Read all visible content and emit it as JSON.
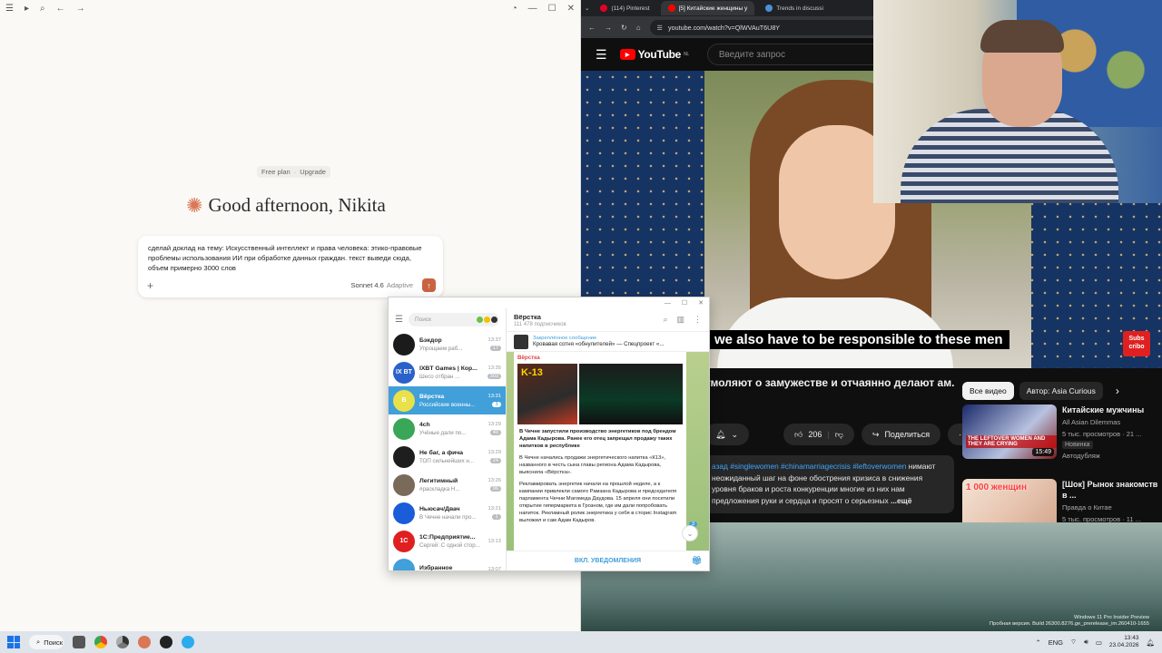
{
  "claude": {
    "plan": "Free plan",
    "upgrade": "Upgrade",
    "greeting": "Good afternoon, Nikita",
    "prompt": "сделай доклад на тему: Искусственный интеллект и права человека: этико-правовые проблемы использования ИИ при обработке данных граждан. текст выведи сюда, объем примерно 3000 слов",
    "model": "Sonnet 4.6",
    "mode": "Adaptive",
    "accent": "#d97757"
  },
  "chrome": {
    "tabs": [
      {
        "label": "(114) Pinterest",
        "color": "#e60023"
      },
      {
        "label": "[5] Китайские женщины у",
        "color": "#ff0000"
      },
      {
        "label": "Trends in discussi",
        "color": "#4a90d9"
      }
    ],
    "url": "youtube.com/watch?v=QlWVAuT6U8Y"
  },
  "youtube": {
    "logo": "YouTube",
    "region": "NL",
    "search_placeholder": "Введите запрос",
    "caption": "we also have to be responsible to these men",
    "subscribe_logo": "Subs cribo",
    "title": "умоляют о замужестве и отчаянно делают ам.",
    "likes": "206",
    "share": "Поделиться",
    "description": {
      "tags": "азад #singlewomen #chinamarriagecrisis #leftoverwomen",
      "text": "нимают неожиданный шаг на фоне обострения кризиса в снижения уровня браков и роста конкуренции многие из них нам предложения руки и сердца и просят о серьезных",
      "more": "...ещё"
    },
    "chips": [
      "Все видео",
      "Автор: Asia Curious"
    ],
    "related": [
      {
        "title": "Китайские мужчины",
        "channel": "All Asian Dilemmas",
        "meta": "5 тыс. просмотров · 21 ...",
        "badge": "Новинка",
        "dub": "Автодубляж",
        "duration": "15:49",
        "thumb_text": "THE LEFTOVER WOMEN AND THEY ARE CRYING"
      },
      {
        "title": "[Шок] Рынок знакомств в ...",
        "channel": "Правда о Китае",
        "meta": "5 тыс. просмотров · 11 ...",
        "badge": "",
        "dub": "",
        "duration": "",
        "thumb_text": "1 000 женщин"
      }
    ]
  },
  "telegram": {
    "search_placeholder": "Поиск",
    "chats": [
      {
        "name": "Бэкдор",
        "preview": "Упрощаем раб...",
        "time": "13:37",
        "count": "17",
        "avatar_color": "#1b1b1b",
        "avatar_text": "",
        "active": false
      },
      {
        "name": "IXBT Games | Кор...",
        "preview": "Шесо отбран ...",
        "time": "13:35",
        "count": "303",
        "avatar_color": "#2a62c9",
        "avatar_text": "IX BT",
        "active": false
      },
      {
        "name": "Вёрстка",
        "preview": "Российские военны...",
        "time": "13:31",
        "count": "3",
        "avatar_color": "#e8e14a",
        "avatar_text": "B",
        "active": true
      },
      {
        "name": "4ch",
        "preview": "Учёные дали по...",
        "time": "13:29",
        "count": "40",
        "avatar_color": "#3aa657",
        "avatar_text": "",
        "active": false
      },
      {
        "name": "Не баг, а фича",
        "preview": "ТОП сильнейших н...",
        "time": "13:29",
        "count": "24",
        "avatar_color": "#1e1e1e",
        "avatar_text": "",
        "active": false
      },
      {
        "name": "Легитимный",
        "preview": "#раскладка Н...",
        "time": "13:26",
        "count": "96",
        "avatar_color": "#7a6a5a",
        "avatar_text": "",
        "active": false
      },
      {
        "name": "Ньюсач/Двач",
        "preview": "В Чечне начали про...",
        "time": "13:21",
        "count": "1",
        "avatar_color": "#1a5dd8",
        "avatar_text": "",
        "active": false
      },
      {
        "name": "1С:Предприятие...",
        "preview": "Сергей: С одной стор...",
        "time": "13:13",
        "count": "",
        "avatar_color": "#e02020",
        "avatar_text": "1С",
        "active": false
      },
      {
        "name": "Избранное",
        "preview": "",
        "time": "13:07",
        "count": "",
        "avatar_color": "#419fd9",
        "avatar_text": "",
        "active": false
      }
    ],
    "channel": {
      "name": "Вёрстка",
      "subscribers": "111 478 подписчиков",
      "pinned_label": "Закреплённое сообщение",
      "pinned_text": "Кровавая сотня «обнулителей» — Спецпроект «...",
      "author": "Вёрстка",
      "image_text": "K-13",
      "paragraphs": [
        "В Чечне запустили производство энергетиков под брендом Адама Кадырова. Ранее его отец запрещал продажу таких напитков в республике",
        "В Чечне начались продажи энергетического напитка «К13», названного в честь сына главы региона Адама Кадырова, выяснила «Вёрстка».",
        "Рекламировать энергетик начали на прошлой неделе, а к кампании привлекли самого Рамзана Кадырова и председателя парламента Чечни Магомеда Даудова. 15 апреля они посетили открытие гипермаркета в Грозном, где им дали попробовать напиток. Рекламный ролик энергетика у себя в сторис Instagram выложил и сам Адам Кадыров."
      ],
      "link_word": "посетили",
      "unread": "3",
      "footer": "ВКЛ. УВЕДОМЛЕНИЯ"
    }
  },
  "watermark": {
    "line1": "Windows 11 Pro Insider Preview",
    "line2": "Пробная версия. Build 26300.8276.ge_prerelease_im.260410-1655"
  },
  "taskbar": {
    "search": "Поиск",
    "lang": "ENG",
    "time": "13:43",
    "date": "23.04.2026"
  }
}
